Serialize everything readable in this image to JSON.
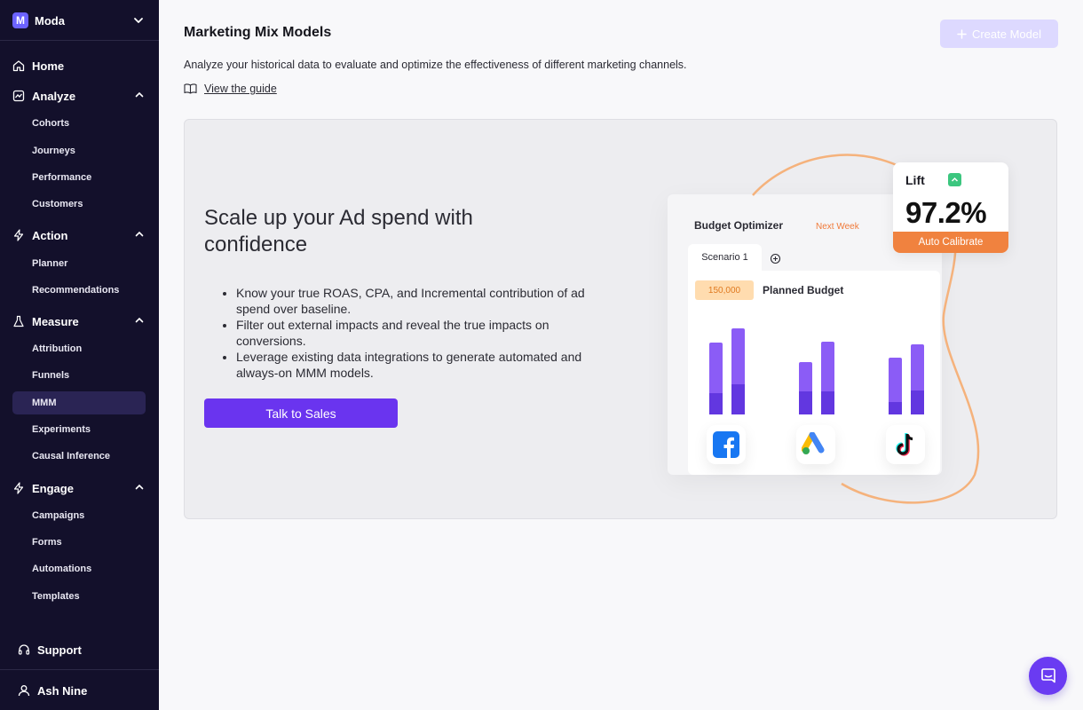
{
  "workspace": {
    "initial": "M",
    "name": "Moda"
  },
  "nav": {
    "home": "Home",
    "analyze": {
      "label": "Analyze",
      "items": [
        "Cohorts",
        "Journeys",
        "Performance",
        "Customers"
      ]
    },
    "action": {
      "label": "Action",
      "items": [
        "Planner",
        "Recommendations"
      ]
    },
    "measure": {
      "label": "Measure",
      "items": [
        "Attribution",
        "Funnels",
        "MMM",
        "Experiments",
        "Causal Inference"
      ]
    },
    "engage": {
      "label": "Engage",
      "items": [
        "Campaigns",
        "Forms",
        "Automations",
        "Templates"
      ]
    },
    "active_item": "MMM",
    "support": "Support",
    "user": "Ash Nine"
  },
  "page": {
    "title": "Marketing Mix Models",
    "create_button": "Create Model",
    "subtitle": "Analyze your historical data to evaluate and optimize the effectiveness of different marketing channels.",
    "guide_link": "View the guide"
  },
  "promo": {
    "headline": "Scale up your Ad spend with confidence",
    "bullets": [
      "Know your true ROAS, CPA, and Incremental contribution of ad spend over baseline.",
      "Filter out external impacts and reveal the true impacts on conversions.",
      "Leverage existing data integrations to generate automated and always-on MMM models."
    ],
    "cta": "Talk to Sales"
  },
  "illustration": {
    "budget_optimizer": "Budget Optimizer",
    "next_week": "Next Week",
    "scenario_tab": "Scenario 1",
    "budget_value": "150,000",
    "planned_budget": "Planned Budget",
    "lift_label": "Lift",
    "lift_value": "97.2%",
    "auto_calibrate": "Auto Calibrate",
    "brands": [
      "facebook-icon",
      "google-ads-icon",
      "tiktok-icon"
    ]
  },
  "colors": {
    "sidebar_bg": "#13102b",
    "accent": "#6a34ef",
    "orange": "#f0823f",
    "green": "#3cc67f"
  }
}
